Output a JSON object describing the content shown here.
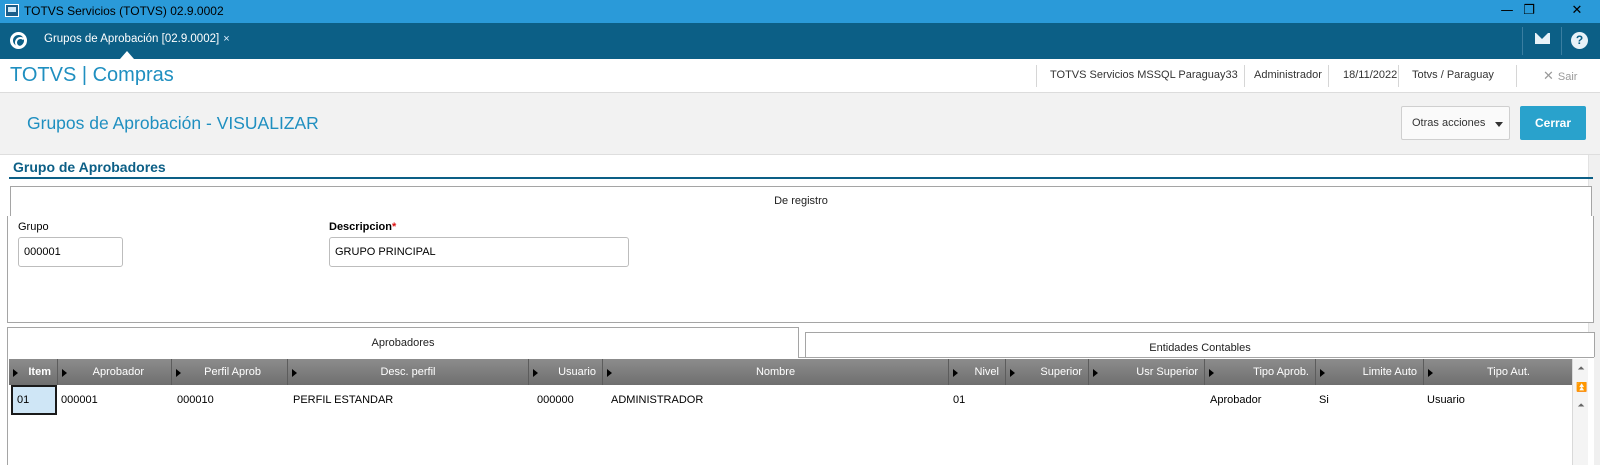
{
  "window": {
    "title": "TOTVS Servicios (TOTVS) 02.9.0002",
    "minimize": "—",
    "restore": "❐",
    "close": "✕"
  },
  "tabbar": {
    "tab_label": "Grupos de Aprobación [02.9.0002]",
    "tab_close": "×"
  },
  "header": {
    "brand": "TOTVS | Compras",
    "company": "TOTVS Servicios MSSQL Paraguay33",
    "user": "Administrador",
    "date": "18/11/2022",
    "branch": "Totvs / Paraguay",
    "exit_label": "Sair",
    "exit_icon": "✕"
  },
  "page": {
    "title": "Grupos de Aprobación - VISUALIZAR",
    "more_actions": "Otras acciones",
    "close_button": "Cerrar"
  },
  "section": {
    "title": "Grupo de Aprobadores",
    "register_tab": "De registro"
  },
  "fields": {
    "grupo_label": "Grupo",
    "grupo_value": "000001",
    "descripcion_label": "Descripcion",
    "descripcion_required": "*",
    "descripcion_value": "GRUPO PRINCIPAL"
  },
  "folders": {
    "tab1": "Aprobadores",
    "tab2": "Entidades Contables"
  },
  "grid": {
    "columns": [
      "Item",
      "Aprobador",
      "Perfil Aprob",
      "Desc. perfil",
      "Usuario",
      "Nombre",
      "Nivel",
      "Superior",
      "Usr Superior",
      "Tipo Aprob.",
      "Limite Auto",
      "Tipo Aut."
    ],
    "rows": [
      [
        "01",
        "000001",
        "000010",
        "PERFIL ESTANDAR",
        "000000",
        "ADMINISTRADOR",
        "01",
        "",
        "",
        "Aprobador",
        "Si",
        "Usuario"
      ]
    ]
  }
}
